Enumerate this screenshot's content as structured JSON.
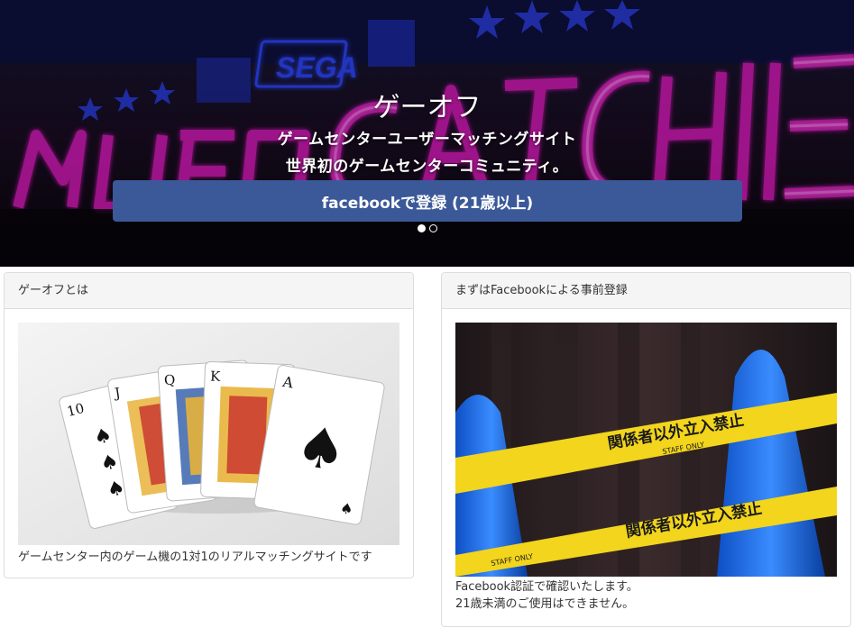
{
  "hero": {
    "title": "ゲーオフ",
    "tagline_1": "ゲームセンターユーザーマッチングサイト",
    "tagline_2": "世界初のゲームセンターコミュニティ。",
    "register_button": "facebookで登録 (21歳以上)",
    "background_sign": {
      "brand": "SEGA",
      "neon_text": "NEW UFO CATCHER",
      "colors": {
        "neon": "#e21cc4",
        "blue": "#2a3bd8"
      }
    },
    "slider": {
      "slides": 2,
      "active": 1
    }
  },
  "panels": {
    "about": {
      "heading": "ゲーオフとは",
      "image": "playing-cards-royal-flush-image",
      "text": "ゲームセンター内のゲーム機の1対1のリアルマッチングサイトです",
      "cards": [
        {
          "rank": "10",
          "suit": "♠"
        },
        {
          "rank": "J",
          "suit": "♠"
        },
        {
          "rank": "Q",
          "suit": "♠"
        },
        {
          "rank": "K",
          "suit": "♠"
        },
        {
          "rank": "A",
          "suit": "♠"
        }
      ]
    },
    "preregister": {
      "heading": "まずはFacebookによる事前登録",
      "image": "keep-out-tape-image",
      "tape_text": "関係者以外立入禁止",
      "tape_sub": "STAFF ONLY",
      "text_1": "Facebook認証で確認いたします。",
      "text_2": "21歳未満のご使用はできません。"
    }
  },
  "colors": {
    "facebook": "#3b5998",
    "panel_heading_bg": "#f5f5f5",
    "panel_border": "#dddddd",
    "tape": "#f2d51c",
    "cone": "#1d6fe0"
  }
}
